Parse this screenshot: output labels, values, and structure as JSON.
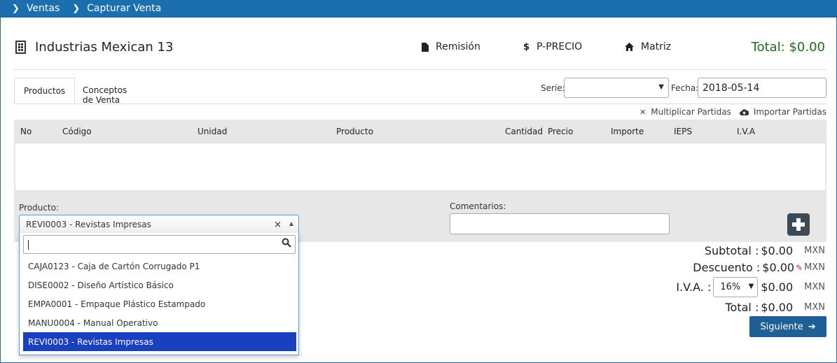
{
  "breadcrumb": {
    "items": [
      "Ventas",
      "Capturar Venta"
    ]
  },
  "header": {
    "company_name": "Industrias Mexican 13",
    "links": {
      "remision": "Remisión",
      "pprecio": "P-PRECIO",
      "matriz": "Matriz"
    },
    "dollar_symbol": "$",
    "total": "Total: $0.00"
  },
  "tabs": [
    "Productos",
    "Conceptos de Venta"
  ],
  "serie": {
    "label": "Serie:",
    "value": ""
  },
  "fecha": {
    "label": "Fecha:",
    "value": "2018-05-14"
  },
  "actions": {
    "multiplicar": "Multiplicar Partidas",
    "importar": "Importar Partidas"
  },
  "grid": {
    "columns": [
      "No",
      "Código",
      "Unidad",
      "Producto",
      "Cantidad",
      "Precio",
      "Importe",
      "IEPS",
      "I.V.A"
    ]
  },
  "form": {
    "producto_label": "Producto:",
    "producto_value": "REVI0003 - Revistas Impresas",
    "comentarios_label": "Comentarios:",
    "comentarios_value": ""
  },
  "dropdown": {
    "search_value": "",
    "options": [
      "CAJA0123 - Caja de Cartón Corrugado P1",
      "DISE0002 - Diseño Artístico Básico",
      "EMPA0001 - Empaque Plástico Estampado",
      "MANU0004 - Manual Operativo",
      "REVI0003 - Revistas Impresas"
    ],
    "selected_index": 4
  },
  "summary": {
    "subtotal": {
      "label": "Subtotal :",
      "value": "$0.00",
      "currency": "MXN"
    },
    "descuento": {
      "label": "Descuento :",
      "value": "$0.00",
      "currency": "MXN"
    },
    "iva": {
      "label": "I.V.A. :",
      "rate": "16%",
      "value": "$0.00",
      "currency": "MXN"
    },
    "total": {
      "label": "Total :",
      "value": "$0.00",
      "currency": "MXN"
    }
  },
  "next_button": {
    "label": "Siguiente"
  },
  "colors": {
    "topbar": "#1b6fae",
    "total_green": "#1d6b1d",
    "selected_option": "#1a3fbf",
    "next_button": "#1f5f95"
  }
}
